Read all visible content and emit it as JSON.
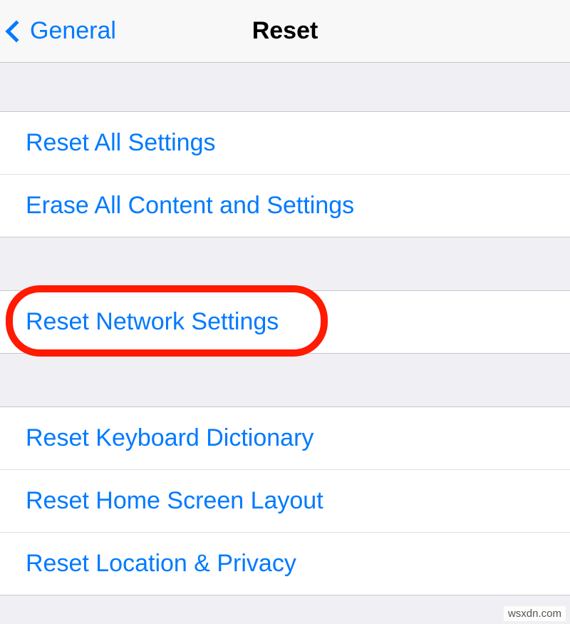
{
  "navbar": {
    "back_label": "General",
    "title": "Reset"
  },
  "groups": [
    {
      "items": [
        {
          "label": "Reset All Settings"
        },
        {
          "label": "Erase All Content and Settings"
        }
      ]
    },
    {
      "items": [
        {
          "label": "Reset Network Settings",
          "highlighted": true
        }
      ]
    },
    {
      "items": [
        {
          "label": "Reset Keyboard Dictionary"
        },
        {
          "label": "Reset Home Screen Layout"
        },
        {
          "label": "Reset Location & Privacy"
        }
      ]
    }
  ],
  "watermark": "wsxdn.com"
}
